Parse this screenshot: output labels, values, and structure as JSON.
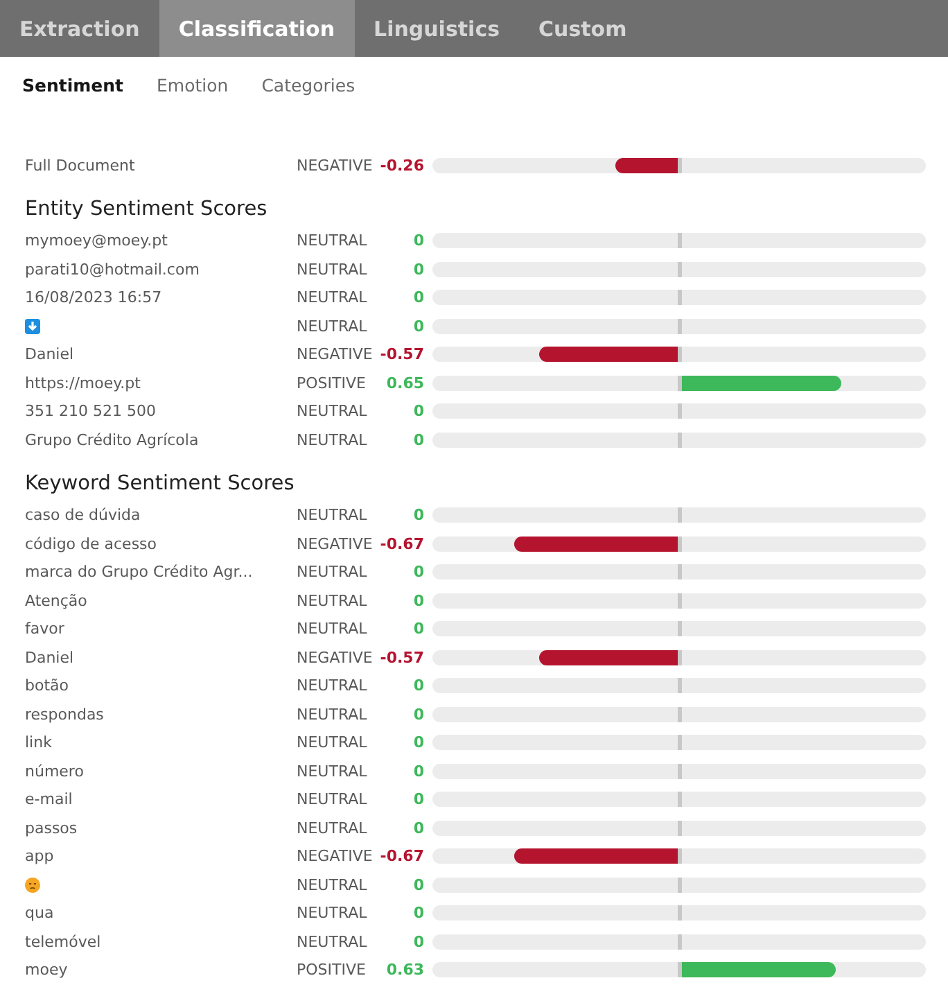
{
  "tabs": [
    {
      "label": "Extraction",
      "selected": false
    },
    {
      "label": "Classification",
      "selected": true
    },
    {
      "label": "Linguistics",
      "selected": false
    },
    {
      "label": "Custom",
      "selected": false
    }
  ],
  "subtabs": [
    {
      "label": "Sentiment",
      "selected": true
    },
    {
      "label": "Emotion",
      "selected": false
    },
    {
      "label": "Categories",
      "selected": false
    }
  ],
  "document": {
    "kind": "text",
    "name": "Full Document",
    "sentiment": "NEGATIVE",
    "score": "-0.26"
  },
  "sections": [
    {
      "title": "Entity Sentiment Scores",
      "rows": [
        {
          "kind": "text",
          "name": "mymoey@moey.pt",
          "sentiment": "NEUTRAL",
          "score": "0"
        },
        {
          "kind": "text",
          "name": "parati10@hotmail.com",
          "sentiment": "NEUTRAL",
          "score": "0"
        },
        {
          "kind": "text",
          "name": "16/08/2023 16:57",
          "sentiment": "NEUTRAL",
          "score": "0"
        },
        {
          "kind": "download",
          "sentiment": "NEUTRAL",
          "score": "0"
        },
        {
          "kind": "text",
          "name": "Daniel",
          "sentiment": "NEGATIVE",
          "score": "-0.57"
        },
        {
          "kind": "text",
          "name": "https://moey.pt",
          "sentiment": "POSITIVE",
          "score": "0.65"
        },
        {
          "kind": "text",
          "name": "351 210 521 500",
          "sentiment": "NEUTRAL",
          "score": "0"
        },
        {
          "kind": "text",
          "name": "Grupo Crédito Agrícola",
          "sentiment": "NEUTRAL",
          "score": "0"
        }
      ]
    },
    {
      "title": "Keyword Sentiment Scores",
      "rows": [
        {
          "kind": "text",
          "name": "caso de dúvida",
          "sentiment": "NEUTRAL",
          "score": "0"
        },
        {
          "kind": "text",
          "name": "código de acesso",
          "sentiment": "NEGATIVE",
          "score": "-0.67"
        },
        {
          "kind": "text",
          "name": "marca do Grupo Crédito Agr...",
          "sentiment": "NEUTRAL",
          "score": "0"
        },
        {
          "kind": "text",
          "name": "Atenção",
          "sentiment": "NEUTRAL",
          "score": "0"
        },
        {
          "kind": "text",
          "name": "favor",
          "sentiment": "NEUTRAL",
          "score": "0"
        },
        {
          "kind": "text",
          "name": "Daniel",
          "sentiment": "NEGATIVE",
          "score": "-0.57"
        },
        {
          "kind": "text",
          "name": "botão",
          "sentiment": "NEUTRAL",
          "score": "0"
        },
        {
          "kind": "text",
          "name": "respondas",
          "sentiment": "NEUTRAL",
          "score": "0"
        },
        {
          "kind": "text",
          "name": "link",
          "sentiment": "NEUTRAL",
          "score": "0"
        },
        {
          "kind": "text",
          "name": "número",
          "sentiment": "NEUTRAL",
          "score": "0"
        },
        {
          "kind": "text",
          "name": "e-mail",
          "sentiment": "NEUTRAL",
          "score": "0"
        },
        {
          "kind": "text",
          "name": "passos",
          "sentiment": "NEUTRAL",
          "score": "0"
        },
        {
          "kind": "text",
          "name": "app",
          "sentiment": "NEGATIVE",
          "score": "-0.67"
        },
        {
          "kind": "face",
          "sentiment": "NEUTRAL",
          "score": "0"
        },
        {
          "kind": "text",
          "name": "qua",
          "sentiment": "NEUTRAL",
          "score": "0"
        },
        {
          "kind": "text",
          "name": "telemóvel",
          "sentiment": "NEUTRAL",
          "score": "0"
        },
        {
          "kind": "text",
          "name": "moey",
          "sentiment": "POSITIVE",
          "score": "0.63"
        }
      ]
    }
  ]
}
